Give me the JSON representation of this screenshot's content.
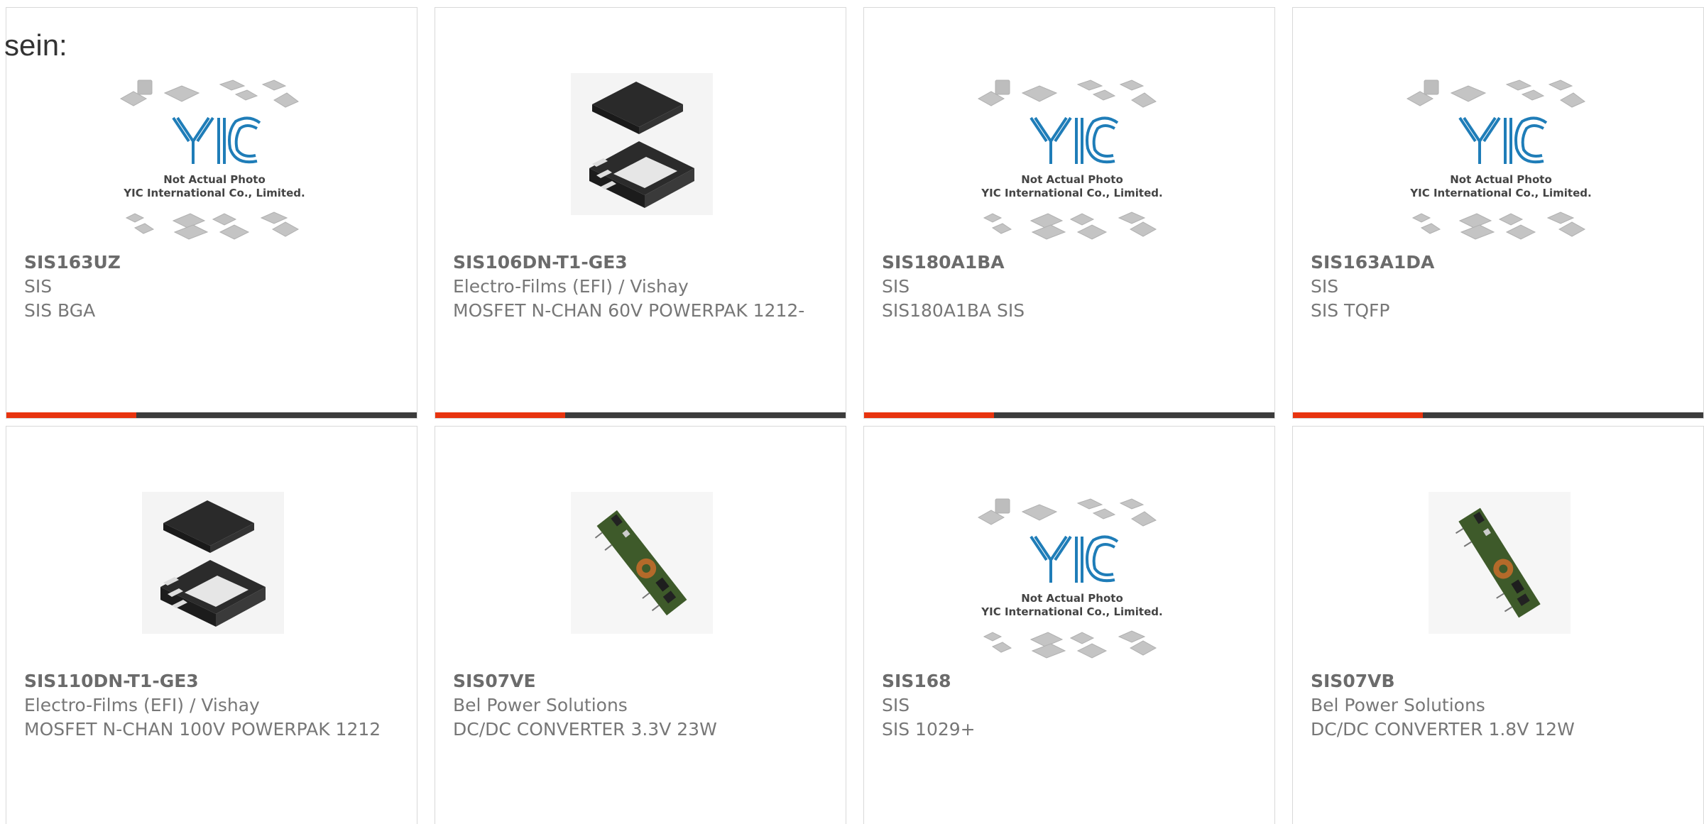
{
  "intro_text": "sein:",
  "colors": {
    "accent": "#e8340f",
    "bar": "#3c3c3c",
    "text": "#777777"
  },
  "placeholder": {
    "line1": "Not Actual Photo",
    "line2": "YIC International Co., Limited."
  },
  "products": [
    {
      "part": "SIS163UZ",
      "maker": "SIS",
      "desc": "SIS BGA",
      "image": "placeholder-logo"
    },
    {
      "part": "SIS106DN-T1-GE3",
      "maker": "Electro-Films (EFI) / Vishay",
      "desc": "MOSFET N-CHAN 60V POWERPAK 1212-",
      "image": "qfn-chip"
    },
    {
      "part": "SIS180A1BA",
      "maker": "SIS",
      "desc": "SIS180A1BA SIS",
      "image": "placeholder-logo"
    },
    {
      "part": "SIS163A1DA",
      "maker": "SIS",
      "desc": "SIS TQFP",
      "image": "placeholder-logo"
    },
    {
      "part": "SIS110DN-T1-GE3",
      "maker": "Electro-Films (EFI) / Vishay",
      "desc": "MOSFET N-CHAN 100V POWERPAK 1212",
      "image": "qfn-chip"
    },
    {
      "part": "SIS07VE",
      "maker": "Bel Power Solutions",
      "desc": "DC/DC CONVERTER 3.3V 23W",
      "image": "pcb-module"
    },
    {
      "part": "SIS168",
      "maker": "SIS",
      "desc": "SIS 1029+",
      "image": "placeholder-logo"
    },
    {
      "part": "SIS07VB",
      "maker": "Bel Power Solutions",
      "desc": "DC/DC CONVERTER 1.8V 12W",
      "image": "pcb-module"
    }
  ]
}
